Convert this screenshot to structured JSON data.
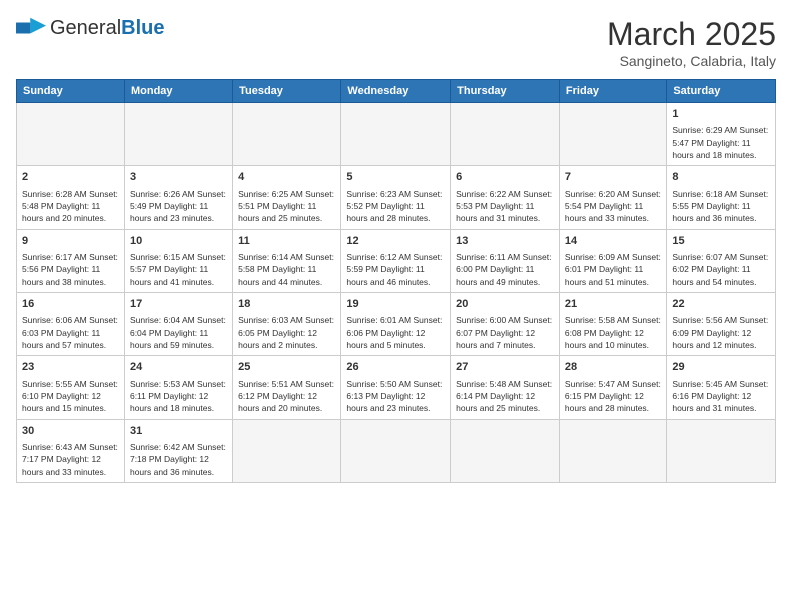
{
  "header": {
    "logo_general": "General",
    "logo_blue": "Blue",
    "month_title": "March 2025",
    "location": "Sangineto, Calabria, Italy"
  },
  "columns": [
    "Sunday",
    "Monday",
    "Tuesday",
    "Wednesday",
    "Thursday",
    "Friday",
    "Saturday"
  ],
  "weeks": [
    [
      {
        "day": "",
        "info": ""
      },
      {
        "day": "",
        "info": ""
      },
      {
        "day": "",
        "info": ""
      },
      {
        "day": "",
        "info": ""
      },
      {
        "day": "",
        "info": ""
      },
      {
        "day": "",
        "info": ""
      },
      {
        "day": "1",
        "info": "Sunrise: 6:29 AM\nSunset: 5:47 PM\nDaylight: 11 hours and 18 minutes."
      }
    ],
    [
      {
        "day": "2",
        "info": "Sunrise: 6:28 AM\nSunset: 5:48 PM\nDaylight: 11 hours and 20 minutes."
      },
      {
        "day": "3",
        "info": "Sunrise: 6:26 AM\nSunset: 5:49 PM\nDaylight: 11 hours and 23 minutes."
      },
      {
        "day": "4",
        "info": "Sunrise: 6:25 AM\nSunset: 5:51 PM\nDaylight: 11 hours and 25 minutes."
      },
      {
        "day": "5",
        "info": "Sunrise: 6:23 AM\nSunset: 5:52 PM\nDaylight: 11 hours and 28 minutes."
      },
      {
        "day": "6",
        "info": "Sunrise: 6:22 AM\nSunset: 5:53 PM\nDaylight: 11 hours and 31 minutes."
      },
      {
        "day": "7",
        "info": "Sunrise: 6:20 AM\nSunset: 5:54 PM\nDaylight: 11 hours and 33 minutes."
      },
      {
        "day": "8",
        "info": "Sunrise: 6:18 AM\nSunset: 5:55 PM\nDaylight: 11 hours and 36 minutes."
      }
    ],
    [
      {
        "day": "9",
        "info": "Sunrise: 6:17 AM\nSunset: 5:56 PM\nDaylight: 11 hours and 38 minutes."
      },
      {
        "day": "10",
        "info": "Sunrise: 6:15 AM\nSunset: 5:57 PM\nDaylight: 11 hours and 41 minutes."
      },
      {
        "day": "11",
        "info": "Sunrise: 6:14 AM\nSunset: 5:58 PM\nDaylight: 11 hours and 44 minutes."
      },
      {
        "day": "12",
        "info": "Sunrise: 6:12 AM\nSunset: 5:59 PM\nDaylight: 11 hours and 46 minutes."
      },
      {
        "day": "13",
        "info": "Sunrise: 6:11 AM\nSunset: 6:00 PM\nDaylight: 11 hours and 49 minutes."
      },
      {
        "day": "14",
        "info": "Sunrise: 6:09 AM\nSunset: 6:01 PM\nDaylight: 11 hours and 51 minutes."
      },
      {
        "day": "15",
        "info": "Sunrise: 6:07 AM\nSunset: 6:02 PM\nDaylight: 11 hours and 54 minutes."
      }
    ],
    [
      {
        "day": "16",
        "info": "Sunrise: 6:06 AM\nSunset: 6:03 PM\nDaylight: 11 hours and 57 minutes."
      },
      {
        "day": "17",
        "info": "Sunrise: 6:04 AM\nSunset: 6:04 PM\nDaylight: 11 hours and 59 minutes."
      },
      {
        "day": "18",
        "info": "Sunrise: 6:03 AM\nSunset: 6:05 PM\nDaylight: 12 hours and 2 minutes."
      },
      {
        "day": "19",
        "info": "Sunrise: 6:01 AM\nSunset: 6:06 PM\nDaylight: 12 hours and 5 minutes."
      },
      {
        "day": "20",
        "info": "Sunrise: 6:00 AM\nSunset: 6:07 PM\nDaylight: 12 hours and 7 minutes."
      },
      {
        "day": "21",
        "info": "Sunrise: 5:58 AM\nSunset: 6:08 PM\nDaylight: 12 hours and 10 minutes."
      },
      {
        "day": "22",
        "info": "Sunrise: 5:56 AM\nSunset: 6:09 PM\nDaylight: 12 hours and 12 minutes."
      }
    ],
    [
      {
        "day": "23",
        "info": "Sunrise: 5:55 AM\nSunset: 6:10 PM\nDaylight: 12 hours and 15 minutes."
      },
      {
        "day": "24",
        "info": "Sunrise: 5:53 AM\nSunset: 6:11 PM\nDaylight: 12 hours and 18 minutes."
      },
      {
        "day": "25",
        "info": "Sunrise: 5:51 AM\nSunset: 6:12 PM\nDaylight: 12 hours and 20 minutes."
      },
      {
        "day": "26",
        "info": "Sunrise: 5:50 AM\nSunset: 6:13 PM\nDaylight: 12 hours and 23 minutes."
      },
      {
        "day": "27",
        "info": "Sunrise: 5:48 AM\nSunset: 6:14 PM\nDaylight: 12 hours and 25 minutes."
      },
      {
        "day": "28",
        "info": "Sunrise: 5:47 AM\nSunset: 6:15 PM\nDaylight: 12 hours and 28 minutes."
      },
      {
        "day": "29",
        "info": "Sunrise: 5:45 AM\nSunset: 6:16 PM\nDaylight: 12 hours and 31 minutes."
      }
    ],
    [
      {
        "day": "30",
        "info": "Sunrise: 6:43 AM\nSunset: 7:17 PM\nDaylight: 12 hours and 33 minutes."
      },
      {
        "day": "31",
        "info": "Sunrise: 6:42 AM\nSunset: 7:18 PM\nDaylight: 12 hours and 36 minutes."
      },
      {
        "day": "",
        "info": ""
      },
      {
        "day": "",
        "info": ""
      },
      {
        "day": "",
        "info": ""
      },
      {
        "day": "",
        "info": ""
      },
      {
        "day": "",
        "info": ""
      }
    ]
  ]
}
